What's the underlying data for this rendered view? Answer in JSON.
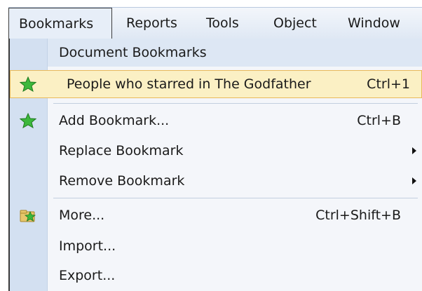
{
  "menubar": {
    "items": [
      "Bookmarks",
      "Reports",
      "Tools",
      "Object",
      "Window"
    ]
  },
  "dropdown": {
    "header": "Document Bookmarks",
    "highlighted": {
      "label": "People who starred in The Godfather",
      "shortcut": "Ctrl+1",
      "icon": "star-icon"
    },
    "items": [
      {
        "label": "Add Bookmark...",
        "shortcut": "Ctrl+B",
        "icon": "star-icon"
      },
      {
        "label": "Replace Bookmark",
        "submenu": true
      },
      {
        "label": "Remove Bookmark",
        "submenu": true
      },
      {
        "label": "More...",
        "shortcut": "Ctrl+Shift+B",
        "icon": "star-folder-icon"
      },
      {
        "label": "Import..."
      },
      {
        "label": "Export..."
      }
    ]
  },
  "colors": {
    "menubar_bg": "#e4ecf6",
    "gutter": "#d3e0f1",
    "highlight_bg": "#fbf0c4",
    "highlight_border": "#e8b95a",
    "star_green": "#3cb83c"
  }
}
